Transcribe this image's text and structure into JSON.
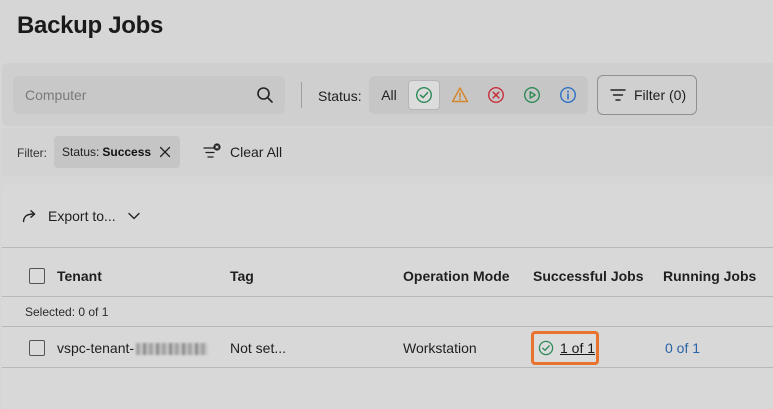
{
  "page": {
    "title": "Backup Jobs"
  },
  "toolbar": {
    "search_placeholder": "Computer",
    "status_label": "Status:",
    "status_all_label": "All",
    "filter_button_label": "Filter (0)"
  },
  "filter_bar": {
    "label": "Filter:",
    "chip_key": "Status:",
    "chip_value": "Success",
    "clear_all_label": "Clear All"
  },
  "export": {
    "label": "Export to..."
  },
  "table": {
    "columns": [
      "Tenant",
      "Tag",
      "Operation Mode",
      "Successful Jobs",
      "Running Jobs"
    ],
    "selected_text": "Selected: 0 of 1",
    "rows": [
      {
        "tenant": "vspc-tenant-",
        "tag": "Not set...",
        "operation_mode": "Workstation",
        "successful_jobs": "1 of 1",
        "running_jobs": "0 of 1"
      }
    ]
  },
  "colors": {
    "highlight": "#e8732f",
    "link": "#2b64a6",
    "success": "#2e8b57",
    "warning": "#d4862a",
    "error": "#c8323c",
    "running": "#2e8b57",
    "info": "#2e72c4"
  }
}
